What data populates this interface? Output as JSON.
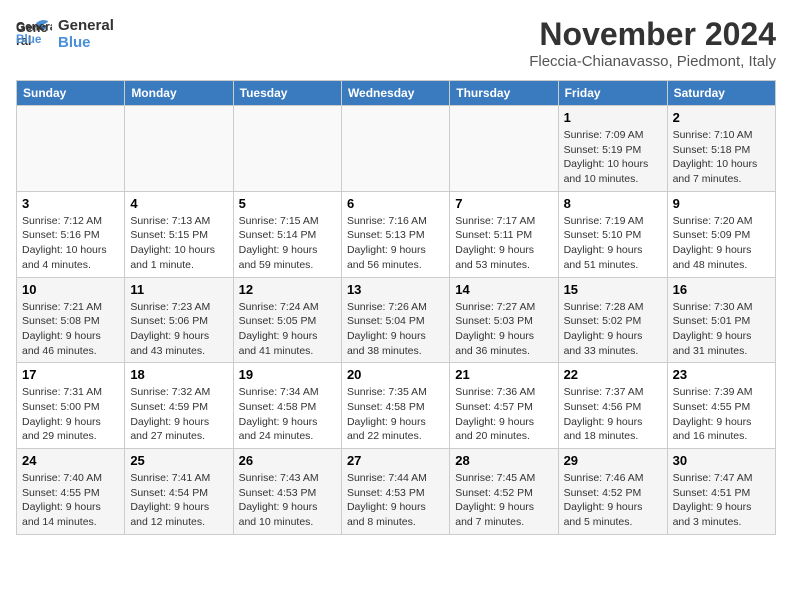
{
  "logo": {
    "line1": "General",
    "line2": "Blue"
  },
  "title": "November 2024",
  "location": "Fleccia-Chianavasso, Piedmont, Italy",
  "weekdays": [
    "Sunday",
    "Monday",
    "Tuesday",
    "Wednesday",
    "Thursday",
    "Friday",
    "Saturday"
  ],
  "weeks": [
    [
      {
        "day": "",
        "info": ""
      },
      {
        "day": "",
        "info": ""
      },
      {
        "day": "",
        "info": ""
      },
      {
        "day": "",
        "info": ""
      },
      {
        "day": "",
        "info": ""
      },
      {
        "day": "1",
        "info": "Sunrise: 7:09 AM\nSunset: 5:19 PM\nDaylight: 10 hours and 10 minutes."
      },
      {
        "day": "2",
        "info": "Sunrise: 7:10 AM\nSunset: 5:18 PM\nDaylight: 10 hours and 7 minutes."
      }
    ],
    [
      {
        "day": "3",
        "info": "Sunrise: 7:12 AM\nSunset: 5:16 PM\nDaylight: 10 hours and 4 minutes."
      },
      {
        "day": "4",
        "info": "Sunrise: 7:13 AM\nSunset: 5:15 PM\nDaylight: 10 hours and 1 minute."
      },
      {
        "day": "5",
        "info": "Sunrise: 7:15 AM\nSunset: 5:14 PM\nDaylight: 9 hours and 59 minutes."
      },
      {
        "day": "6",
        "info": "Sunrise: 7:16 AM\nSunset: 5:13 PM\nDaylight: 9 hours and 56 minutes."
      },
      {
        "day": "7",
        "info": "Sunrise: 7:17 AM\nSunset: 5:11 PM\nDaylight: 9 hours and 53 minutes."
      },
      {
        "day": "8",
        "info": "Sunrise: 7:19 AM\nSunset: 5:10 PM\nDaylight: 9 hours and 51 minutes."
      },
      {
        "day": "9",
        "info": "Sunrise: 7:20 AM\nSunset: 5:09 PM\nDaylight: 9 hours and 48 minutes."
      }
    ],
    [
      {
        "day": "10",
        "info": "Sunrise: 7:21 AM\nSunset: 5:08 PM\nDaylight: 9 hours and 46 minutes."
      },
      {
        "day": "11",
        "info": "Sunrise: 7:23 AM\nSunset: 5:06 PM\nDaylight: 9 hours and 43 minutes."
      },
      {
        "day": "12",
        "info": "Sunrise: 7:24 AM\nSunset: 5:05 PM\nDaylight: 9 hours and 41 minutes."
      },
      {
        "day": "13",
        "info": "Sunrise: 7:26 AM\nSunset: 5:04 PM\nDaylight: 9 hours and 38 minutes."
      },
      {
        "day": "14",
        "info": "Sunrise: 7:27 AM\nSunset: 5:03 PM\nDaylight: 9 hours and 36 minutes."
      },
      {
        "day": "15",
        "info": "Sunrise: 7:28 AM\nSunset: 5:02 PM\nDaylight: 9 hours and 33 minutes."
      },
      {
        "day": "16",
        "info": "Sunrise: 7:30 AM\nSunset: 5:01 PM\nDaylight: 9 hours and 31 minutes."
      }
    ],
    [
      {
        "day": "17",
        "info": "Sunrise: 7:31 AM\nSunset: 5:00 PM\nDaylight: 9 hours and 29 minutes."
      },
      {
        "day": "18",
        "info": "Sunrise: 7:32 AM\nSunset: 4:59 PM\nDaylight: 9 hours and 27 minutes."
      },
      {
        "day": "19",
        "info": "Sunrise: 7:34 AM\nSunset: 4:58 PM\nDaylight: 9 hours and 24 minutes."
      },
      {
        "day": "20",
        "info": "Sunrise: 7:35 AM\nSunset: 4:58 PM\nDaylight: 9 hours and 22 minutes."
      },
      {
        "day": "21",
        "info": "Sunrise: 7:36 AM\nSunset: 4:57 PM\nDaylight: 9 hours and 20 minutes."
      },
      {
        "day": "22",
        "info": "Sunrise: 7:37 AM\nSunset: 4:56 PM\nDaylight: 9 hours and 18 minutes."
      },
      {
        "day": "23",
        "info": "Sunrise: 7:39 AM\nSunset: 4:55 PM\nDaylight: 9 hours and 16 minutes."
      }
    ],
    [
      {
        "day": "24",
        "info": "Sunrise: 7:40 AM\nSunset: 4:55 PM\nDaylight: 9 hours and 14 minutes."
      },
      {
        "day": "25",
        "info": "Sunrise: 7:41 AM\nSunset: 4:54 PM\nDaylight: 9 hours and 12 minutes."
      },
      {
        "day": "26",
        "info": "Sunrise: 7:43 AM\nSunset: 4:53 PM\nDaylight: 9 hours and 10 minutes."
      },
      {
        "day": "27",
        "info": "Sunrise: 7:44 AM\nSunset: 4:53 PM\nDaylight: 9 hours and 8 minutes."
      },
      {
        "day": "28",
        "info": "Sunrise: 7:45 AM\nSunset: 4:52 PM\nDaylight: 9 hours and 7 minutes."
      },
      {
        "day": "29",
        "info": "Sunrise: 7:46 AM\nSunset: 4:52 PM\nDaylight: 9 hours and 5 minutes."
      },
      {
        "day": "30",
        "info": "Sunrise: 7:47 AM\nSunset: 4:51 PM\nDaylight: 9 hours and 3 minutes."
      }
    ]
  ]
}
